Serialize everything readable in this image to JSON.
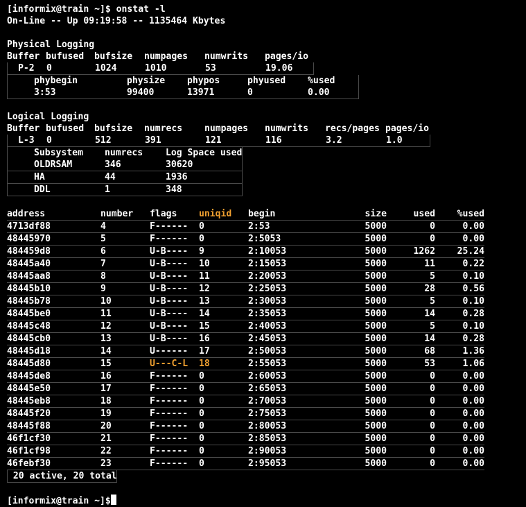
{
  "prompt1": "[informix@train ~]$ onstat -l",
  "status_line": "On-Line -- Up 09:19:58 -- 1135464 Kbytes",
  "physical": {
    "title": "Physical Logging",
    "headers": [
      "Buffer",
      "bufused",
      "bufsize",
      "numpages",
      "numwrits",
      "pages/io"
    ],
    "row": [
      "P-2",
      "0",
      "1024",
      "1010",
      "53",
      "19.06"
    ],
    "sub_headers": [
      "phybegin",
      "physize",
      "phypos",
      "phyused",
      "%used"
    ],
    "sub_row": [
      "3:53",
      "99400",
      "13971",
      "0",
      "0.00"
    ]
  },
  "logical": {
    "title": "Logical Logging",
    "headers": [
      "Buffer",
      "bufused",
      "bufsize",
      "numrecs",
      "numpages",
      "numwrits",
      "recs/pages",
      "pages/io"
    ],
    "row": [
      "L-3",
      "0",
      "512",
      "391",
      "121",
      "116",
      "3.2",
      "1.0"
    ],
    "sub_headers": [
      "Subsystem",
      "numrecs",
      "Log Space used"
    ],
    "sub_rows": [
      [
        "OLDRSAM",
        "346",
        "30620"
      ],
      [
        "HA",
        "44",
        "1936"
      ],
      [
        "DDL",
        "1",
        "348"
      ]
    ]
  },
  "logs": {
    "headers": [
      "address",
      "number",
      "flags",
      "uniqid",
      "begin",
      "size",
      "used",
      "%used"
    ],
    "rows": [
      [
        "4713df88",
        "4",
        "F------",
        "0",
        "2:53",
        "5000",
        "0",
        "0.00"
      ],
      [
        "48445970",
        "5",
        "F------",
        "0",
        "2:5053",
        "5000",
        "0",
        "0.00"
      ],
      [
        "484459d8",
        "6",
        "U-B----",
        "9",
        "2:10053",
        "5000",
        "1262",
        "25.24"
      ],
      [
        "48445a40",
        "7",
        "U-B----",
        "10",
        "2:15053",
        "5000",
        "11",
        "0.22"
      ],
      [
        "48445aa8",
        "8",
        "U-B----",
        "11",
        "2:20053",
        "5000",
        "5",
        "0.10"
      ],
      [
        "48445b10",
        "9",
        "U-B----",
        "12",
        "2:25053",
        "5000",
        "28",
        "0.56"
      ],
      [
        "48445b78",
        "10",
        "U-B----",
        "13",
        "2:30053",
        "5000",
        "5",
        "0.10"
      ],
      [
        "48445be0",
        "11",
        "U-B----",
        "14",
        "2:35053",
        "5000",
        "14",
        "0.28"
      ],
      [
        "48445c48",
        "12",
        "U-B----",
        "15",
        "2:40053",
        "5000",
        "5",
        "0.10"
      ],
      [
        "48445cb0",
        "13",
        "U-B----",
        "16",
        "2:45053",
        "5000",
        "14",
        "0.28"
      ],
      [
        "48445d18",
        "14",
        "U------",
        "17",
        "2:50053",
        "5000",
        "68",
        "1.36"
      ],
      [
        "48445d80",
        "15",
        "U---C-L",
        "18",
        "2:55053",
        "5000",
        "53",
        "1.06"
      ],
      [
        "48445de8",
        "16",
        "F------",
        "0",
        "2:60053",
        "5000",
        "0",
        "0.00"
      ],
      [
        "48445e50",
        "17",
        "F------",
        "0",
        "2:65053",
        "5000",
        "0",
        "0.00"
      ],
      [
        "48445eb8",
        "18",
        "F------",
        "0",
        "2:70053",
        "5000",
        "0",
        "0.00"
      ],
      [
        "48445f20",
        "19",
        "F------",
        "0",
        "2:75053",
        "5000",
        "0",
        "0.00"
      ],
      [
        "48445f88",
        "20",
        "F------",
        "0",
        "2:80053",
        "5000",
        "0",
        "0.00"
      ],
      [
        "46f1cf30",
        "21",
        "F------",
        "0",
        "2:85053",
        "5000",
        "0",
        "0.00"
      ],
      [
        "46f1cf98",
        "22",
        "F------",
        "0",
        "2:90053",
        "5000",
        "0",
        "0.00"
      ],
      [
        "46febf30",
        "23",
        "F------",
        "0",
        "2:95053",
        "5000",
        "0",
        "0.00"
      ]
    ],
    "current_row_index": 11,
    "summary": " 20 active, 20 total"
  },
  "prompt2": "[informix@train ~]$",
  "colors": {
    "background": "#000000",
    "text": "#ffffff",
    "highlight": "#f0a030"
  }
}
